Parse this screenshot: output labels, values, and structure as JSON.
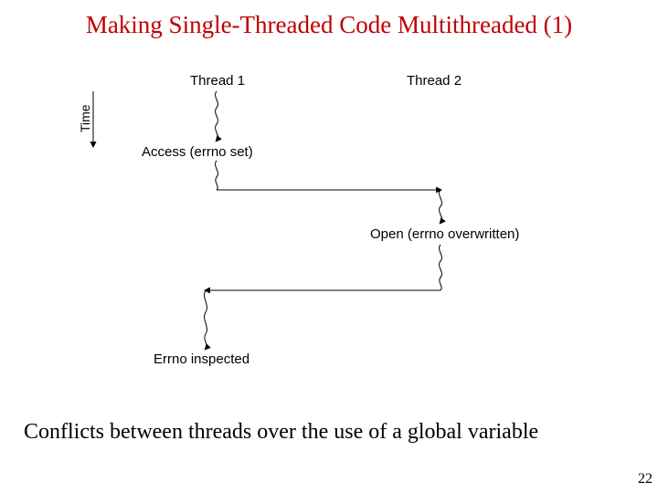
{
  "title": "Making Single-Threaded Code Multithreaded (1)",
  "caption": "Conflicts between threads over the use of a global variable",
  "page_number": "22",
  "diagram": {
    "thread1": "Thread 1",
    "thread2": "Thread 2",
    "time": "Time",
    "access": "Access (errno set)",
    "open": "Open (errno overwritten)",
    "inspected": "Errno inspected"
  }
}
